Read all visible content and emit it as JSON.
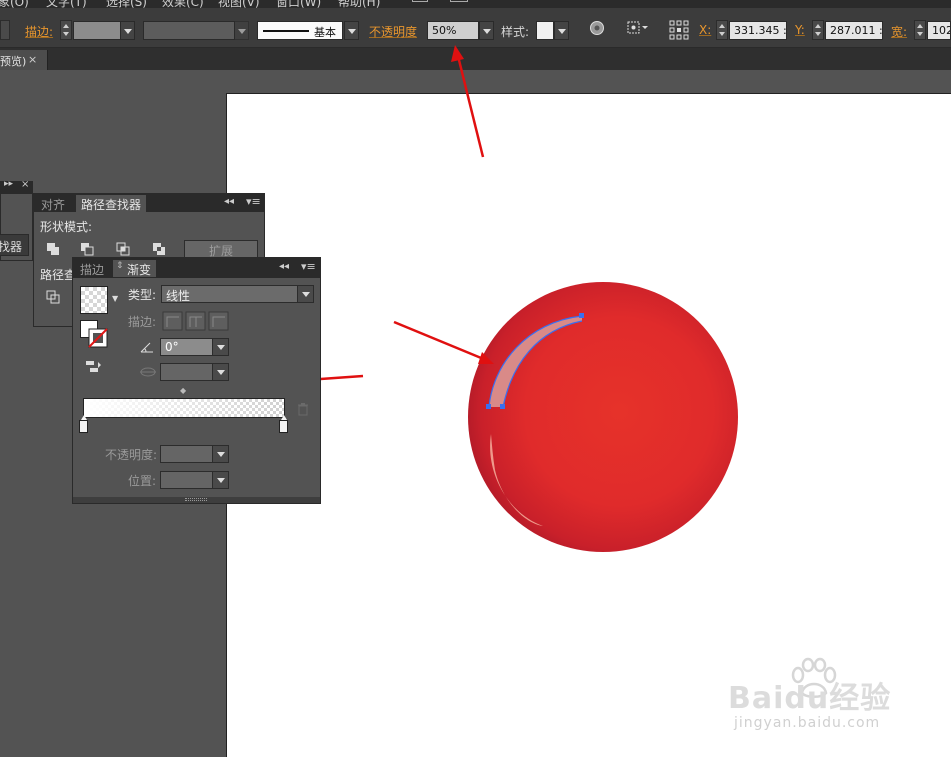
{
  "menubar": {
    "items": [
      "象(O)",
      "文字(T)",
      "选择(S)",
      "效果(C)",
      "视图(V)",
      "窗口(W)",
      "帮助(H)"
    ]
  },
  "control_bar": {
    "stroke_label": "描边:",
    "stroke_style_label": "基本",
    "opacity_label": "不透明度",
    "opacity_value": "50%",
    "style_label": "样式:",
    "x_label": "X:",
    "x_value": "331.345 :",
    "y_label": "Y:",
    "y_value": "287.011 :",
    "width_label": "宽:",
    "width_value": "102"
  },
  "document_tab": {
    "label": "预览)",
    "close": "×"
  },
  "mini_panel": {
    "label": "找器"
  },
  "pathfinder_panel": {
    "tabs": [
      "对齐",
      "路径查找器"
    ],
    "active_tab": 1,
    "shape_modes_label": "形状模式:",
    "expand_button": "扩展",
    "pathfinders_label": "路径查"
  },
  "gradient_panel": {
    "tabs": [
      "描边",
      "渐变"
    ],
    "active_tab": 1,
    "type_label": "类型:",
    "type_value": "线性",
    "stroke_label": "描边:",
    "angle_value": "0°",
    "opacity_label": "不透明度:",
    "location_label": "位置:"
  },
  "colors": {
    "accent_orange": "#e8962e",
    "arrow_red": "#e01010",
    "ball_red": "#e02b2b",
    "selection_blue": "#3a6ff0"
  },
  "watermark": {
    "brand": "Baidu经验",
    "url": "jingyan.baidu.com"
  }
}
